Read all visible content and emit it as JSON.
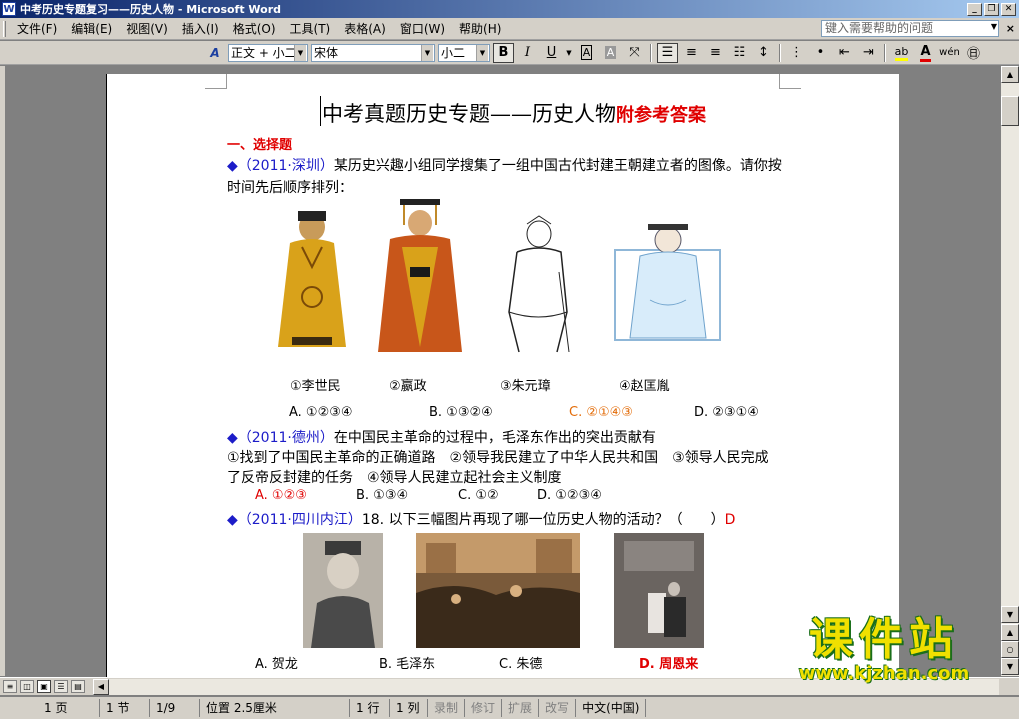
{
  "window": {
    "title": "中考历史专题复习——历史人物 - Microsoft Word",
    "min": "_",
    "restore": "❐",
    "close": "✕"
  },
  "menu": {
    "items": [
      "文件(F)",
      "编辑(E)",
      "视图(V)",
      "插入(I)",
      "格式(O)",
      "工具(T)",
      "表格(A)",
      "窗口(W)",
      "帮助(H)"
    ],
    "help_placeholder": "键入需要帮助的问题",
    "close": "×"
  },
  "toolbar": {
    "style": "正文 + 小二",
    "font": "宋体",
    "size": "小二",
    "bold": "B",
    "italic": "I",
    "underline": "U"
  },
  "document": {
    "title_main": "中考真题历史专题——历史人物",
    "title_suffix": "附参考答案",
    "section1": "一、选择题",
    "q1_source": "◆（2011·深圳）",
    "q1_text": "某历史兴趣小组同学搜集了一组中国古代封建王朝建立者的图像。请你按",
    "q1_text2": "时间先后顺序排列：",
    "q1_captions": [
      "①李世民",
      "②嬴政",
      "③朱元璋",
      "④赵匡胤"
    ],
    "q1_options": [
      "A. ①②③④",
      "B. ①③②④",
      "C. ②①④③",
      "D. ②③①④"
    ],
    "q2_source": "◆（2011·德州）",
    "q2_text": "在中国民主革命的过程中，毛泽东作出的突出贡献有",
    "q2_line2": "①找到了中国民主革命的正确道路　②领导我民建立了中华人民共和国　③领导人民完成",
    "q2_line3": "了反帝反封建的任务　④领导人民建立起社会主义制度",
    "q2_options": [
      "A. ①②③",
      "B. ①③④",
      "C. ①②",
      "D. ①②③④"
    ],
    "q3_source": "◆（2011·四川内江）",
    "q3_text": "18. 以下三幅图片再现了哪一位历史人物的活动？（　　）",
    "q3_answer": "D",
    "q3_options": [
      "A. 贺龙",
      "B. 毛泽东",
      "C. 朱德",
      "D. 周恩来"
    ]
  },
  "status": {
    "page": "1 页",
    "section": "1 节",
    "pages": "1/9",
    "position": "位置 2.5厘米",
    "line": "1 行",
    "col": "1 列",
    "rec": "录制",
    "trk": "修订",
    "ext": "扩展",
    "ovr": "改写",
    "lang": "中文(中国)"
  },
  "watermark": {
    "text": "课件站",
    "url": "www.kjzhan.com"
  },
  "colors": {
    "answer_red": "#e00000",
    "answer_orange": "#e36c09",
    "source_blue": "#1c1cc8",
    "watermark_yellow": "#f0e000"
  }
}
